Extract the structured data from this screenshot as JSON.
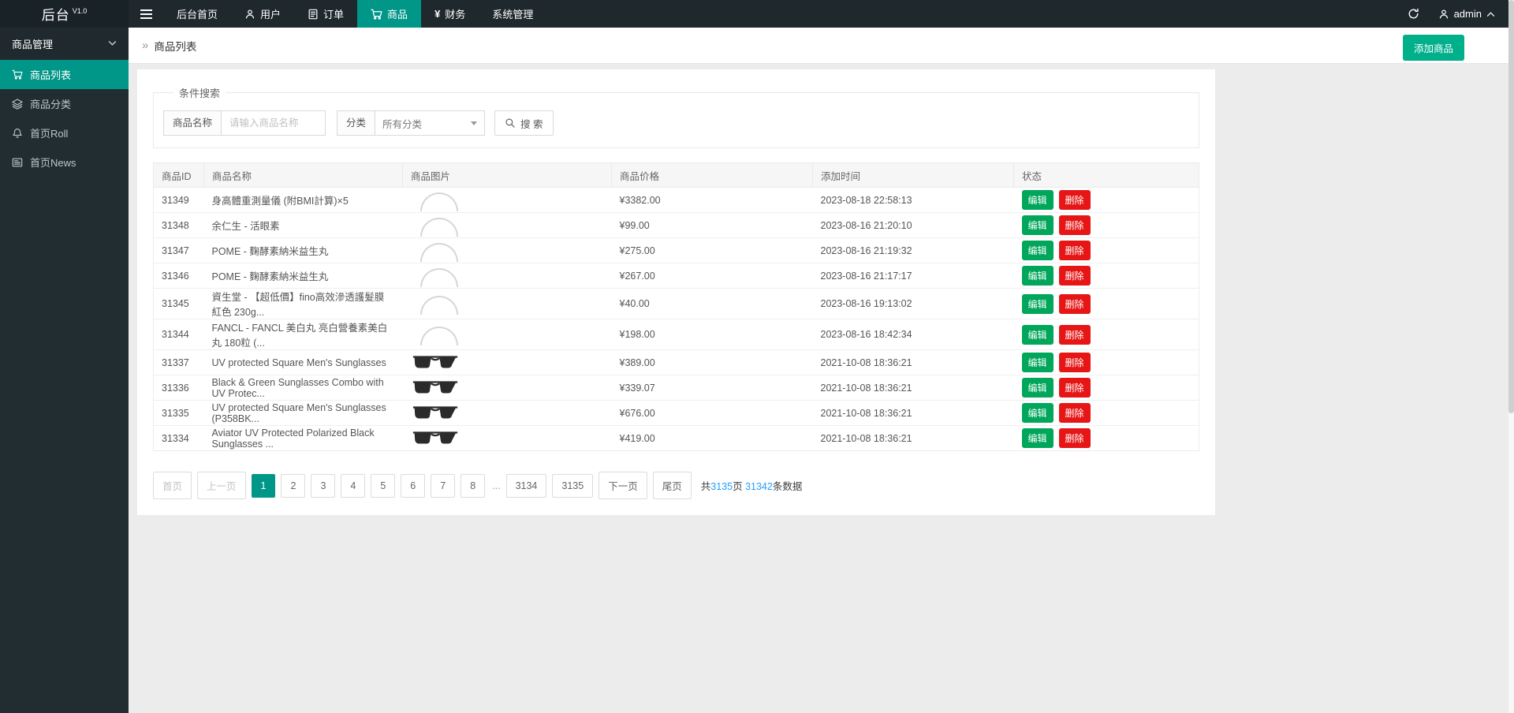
{
  "topbar": {
    "logo": "后台",
    "version": "V1.0",
    "nav": [
      {
        "label": "后台首页"
      },
      {
        "label": "用户"
      },
      {
        "label": "订单"
      },
      {
        "label": "商品",
        "active": true
      },
      {
        "label": "财务",
        "icon_text": "¥"
      },
      {
        "label": "系统管理"
      }
    ],
    "user": "admin"
  },
  "sidebar": {
    "group_label": "商品管理",
    "items": [
      {
        "label": "商品列表",
        "active": true
      },
      {
        "label": "商品分类"
      },
      {
        "label": "首页Roll"
      },
      {
        "label": "首页News"
      }
    ]
  },
  "breadcrumb": {
    "title": "商品列表"
  },
  "actions": {
    "add_product": "添加商品"
  },
  "search": {
    "legend": "条件搜索",
    "name_label": "商品名称",
    "name_placeholder": "请输入商品名称",
    "name_value": "",
    "category_label": "分类",
    "category_value": "所有分类",
    "submit_label": "搜 索"
  },
  "table": {
    "headers": [
      "商品ID",
      "商品名称",
      "商品图片",
      "商品价格",
      "添加时间",
      "状态"
    ],
    "edit_label": "编辑",
    "delete_label": "删除",
    "rows": [
      {
        "id": "31349",
        "name": "身高體重測量儀 (附BMI計算)×5",
        "image": "arc",
        "price": "¥3382.00",
        "time": "2023-08-18 22:58:13"
      },
      {
        "id": "31348",
        "name": "余仁生 - 活眼素",
        "image": "arc",
        "price": "¥99.00",
        "time": "2023-08-16 21:20:10"
      },
      {
        "id": "31347",
        "name": "POME - 麴酵素納米益生丸",
        "image": "arc",
        "price": "¥275.00",
        "time": "2023-08-16 21:19:32"
      },
      {
        "id": "31346",
        "name": "POME - 麴酵素納米益生丸",
        "image": "arc",
        "price": "¥267.00",
        "time": "2023-08-16 21:17:17"
      },
      {
        "id": "31345",
        "name": "資生堂 - 【超低價】fino高效滲透護髮膜 紅色 230g...",
        "image": "arc",
        "price": "¥40.00",
        "time": "2023-08-16 19:13:02"
      },
      {
        "id": "31344",
        "name": "FANCL - FANCL 美白丸 亮白營養素美白丸 180粒 (...",
        "image": "arc",
        "price": "¥198.00",
        "time": "2023-08-16 18:42:34"
      },
      {
        "id": "31337",
        "name": "UV protected Square Men's Sunglasses",
        "image": "glasses",
        "price": "¥389.00",
        "time": "2021-10-08 18:36:21"
      },
      {
        "id": "31336",
        "name": "Black & Green Sunglasses Combo with UV Protec...",
        "image": "glasses",
        "price": "¥339.07",
        "time": "2021-10-08 18:36:21"
      },
      {
        "id": "31335",
        "name": "UV protected Square Men's Sunglasses (P358BK...",
        "image": "glasses",
        "price": "¥676.00",
        "time": "2021-10-08 18:36:21"
      },
      {
        "id": "31334",
        "name": "Aviator UV Protected Polarized Black Sunglasses ...",
        "image": "glasses",
        "price": "¥419.00",
        "time": "2021-10-08 18:36:21"
      }
    ]
  },
  "pagination": {
    "first": "首页",
    "prev": "上一页",
    "pages": [
      "1",
      "2",
      "3",
      "4",
      "5",
      "6",
      "7",
      "8"
    ],
    "gap": "...",
    "far_pages": [
      "3134",
      "3135"
    ],
    "next": "下一页",
    "last": "尾页",
    "active_page": "1",
    "summary": {
      "prefix": "共",
      "total_pages": "3135",
      "pages_word": "页 ",
      "total_records": "31342",
      "records_word": "条数据"
    }
  },
  "colors": {
    "accent": "#009688",
    "add_button_green": "#00b08b",
    "edit_green": "#00a65a",
    "delete_red": "#e61616",
    "link_blue": "#1e9fff",
    "topbar_dark": "#1e282d",
    "sidebar_dark": "#222d32"
  }
}
